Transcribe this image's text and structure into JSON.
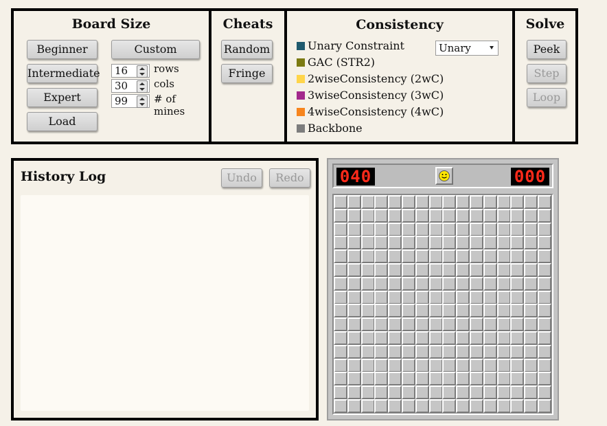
{
  "board_size": {
    "title": "Board Size",
    "buttons": [
      "Beginner",
      "Intermediate",
      "Expert",
      "Load"
    ],
    "custom_label": "Custom",
    "rows": {
      "value": "16",
      "label": "rows"
    },
    "cols": {
      "value": "30",
      "label": "cols"
    },
    "mines": {
      "value": "99",
      "label": "# of mines"
    }
  },
  "cheats": {
    "title": "Cheats",
    "buttons": [
      "Random",
      "Fringe"
    ]
  },
  "consistency": {
    "title": "Consistency",
    "items": [
      {
        "label": "Unary Constraint",
        "color": "#1f5a6e"
      },
      {
        "label": "GAC (STR2)",
        "color": "#7b7a12"
      },
      {
        "label": "2wiseConsistency (2wC)",
        "color": "#ffd54a"
      },
      {
        "label": "3wiseConsistency (3wC)",
        "color": "#a3288c"
      },
      {
        "label": "4wiseConsistency (4wC)",
        "color": "#f7851e"
      },
      {
        "label": "Backbone",
        "color": "#7d7d7d"
      }
    ],
    "selected": "Unary"
  },
  "solve": {
    "title": "Solve",
    "buttons": [
      {
        "label": "Peek",
        "enabled": true
      },
      {
        "label": "Step",
        "enabled": false
      },
      {
        "label": "Loop",
        "enabled": false
      }
    ]
  },
  "history": {
    "title": "History Log",
    "undo_label": "Undo",
    "redo_label": "Redo"
  },
  "game": {
    "mine_counter": "040",
    "timer": "000",
    "face_icon": "smiley-face-icon",
    "rows": 16,
    "cols": 16
  }
}
